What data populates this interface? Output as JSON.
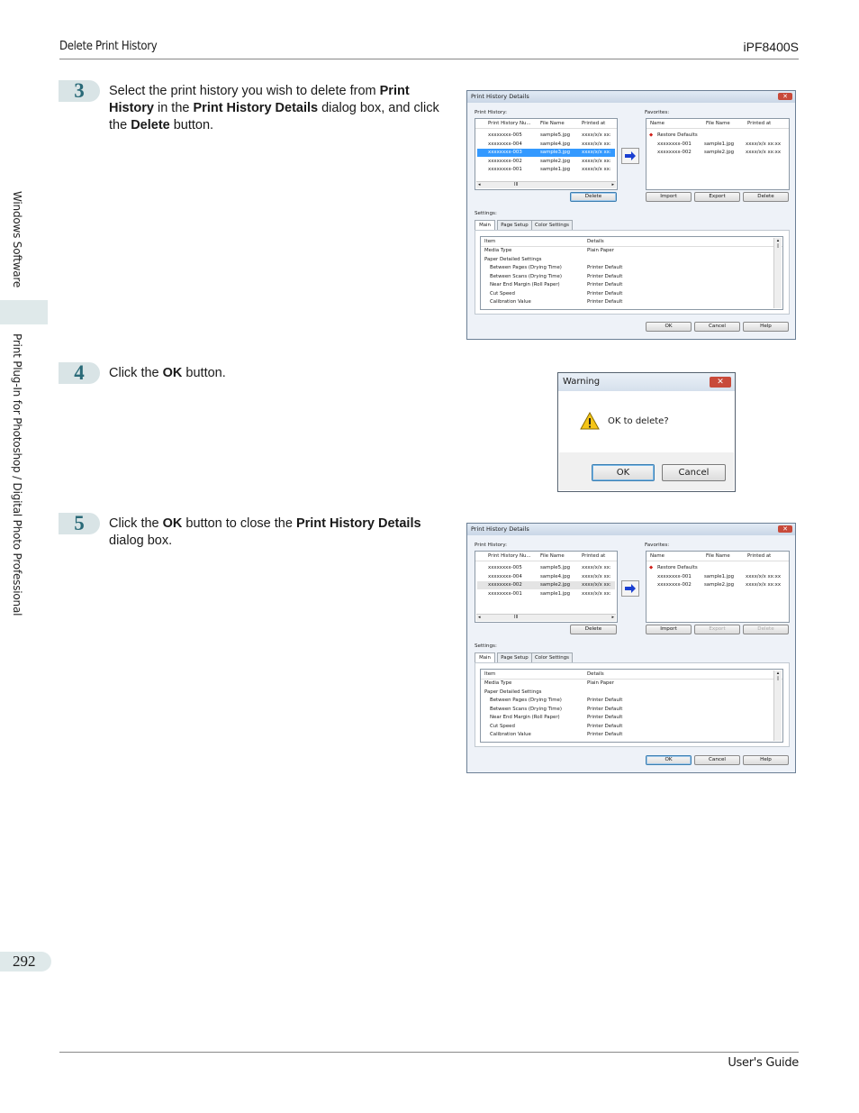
{
  "header": {
    "section": "Delete Print History",
    "model": "iPF8400S"
  },
  "sidebar": {
    "top": "Windows Software",
    "bottom": "Print Plug-In for Photoshop / Digital Photo Professional"
  },
  "steps": [
    {
      "num": "3",
      "parts": [
        "Select the print history you wish to delete from ",
        "Print History",
        " in the ",
        "Print History Details",
        " dialog box, and click the ",
        "Delete",
        " button."
      ]
    },
    {
      "num": "4",
      "parts": [
        "Click the ",
        "OK",
        " button."
      ]
    },
    {
      "num": "5",
      "parts": [
        "Click the ",
        "OK",
        " button to close the ",
        "Print History Details",
        " dialog box."
      ]
    }
  ],
  "dialog1": {
    "title": "Print History Details",
    "print_history_label": "Print History:",
    "favorites_label": "Favorites:",
    "history_cols": [
      "Print History Nu...",
      "File Name",
      "Printed at"
    ],
    "history_rows": [
      [
        "xxxxxxxx-005",
        "sample5.jpg",
        "xxxx/x/x xx:"
      ],
      [
        "xxxxxxxx-004",
        "sample4.jpg",
        "xxxx/x/x xx:"
      ],
      [
        "xxxxxxxx-003",
        "sample3.jpg",
        "xxxx/x/x xx:"
      ],
      [
        "xxxxxxxx-002",
        "sample2.jpg",
        "xxxx/x/x xx:"
      ],
      [
        "xxxxxxxx-001",
        "sample1.jpg",
        "xxxx/x/x xx:"
      ]
    ],
    "fav_cols": [
      "Name",
      "File Name",
      "Printed at"
    ],
    "fav_rows": [
      [
        "Restore Defaults",
        "",
        ""
      ],
      [
        "xxxxxxxx-001",
        "sample1.jpg",
        "xxxx/x/x xx:xx"
      ],
      [
        "xxxxxxxx-002",
        "sample2.jpg",
        "xxxx/x/x xx:xx"
      ]
    ],
    "delete": "Delete",
    "import": "Import",
    "export": "Export",
    "fav_delete": "Delete",
    "settings_label": "Settings:",
    "tabs": [
      "Main",
      "Page Setup",
      "Color Settings"
    ],
    "settings_cols": [
      "Item",
      "Details"
    ],
    "settings_rows": [
      [
        "Media Type",
        "Plain Paper"
      ],
      [
        "Paper Detailed Settings",
        ""
      ],
      [
        "  Between Pages (Drying Time)",
        "Printer Default"
      ],
      [
        "  Between Scans (Drying Time)",
        "Printer Default"
      ],
      [
        "  Near End Margin (Roll Paper)",
        "Printer Default"
      ],
      [
        "  Cut Speed",
        "Printer Default"
      ],
      [
        "  Calibration Value",
        "Printer Default"
      ]
    ],
    "ok": "OK",
    "cancel": "Cancel",
    "help": "Help",
    "scroll_mark": "III"
  },
  "dialog2": {
    "history_rows": [
      [
        "xxxxxxxx-005",
        "sample5.jpg",
        "xxxx/x/x xx:"
      ],
      [
        "xxxxxxxx-004",
        "sample4.jpg",
        "xxxx/x/x xx:"
      ],
      [
        "xxxxxxxx-002",
        "sample2.jpg",
        "xxxx/x/x xx:"
      ],
      [
        "xxxxxxxx-001",
        "sample1.jpg",
        "xxxx/x/x xx:"
      ]
    ]
  },
  "warning": {
    "title": "Warning",
    "message": "OK to delete?",
    "ok": "OK",
    "cancel": "Cancel"
  },
  "page_number": "292",
  "footer": "User's Guide"
}
